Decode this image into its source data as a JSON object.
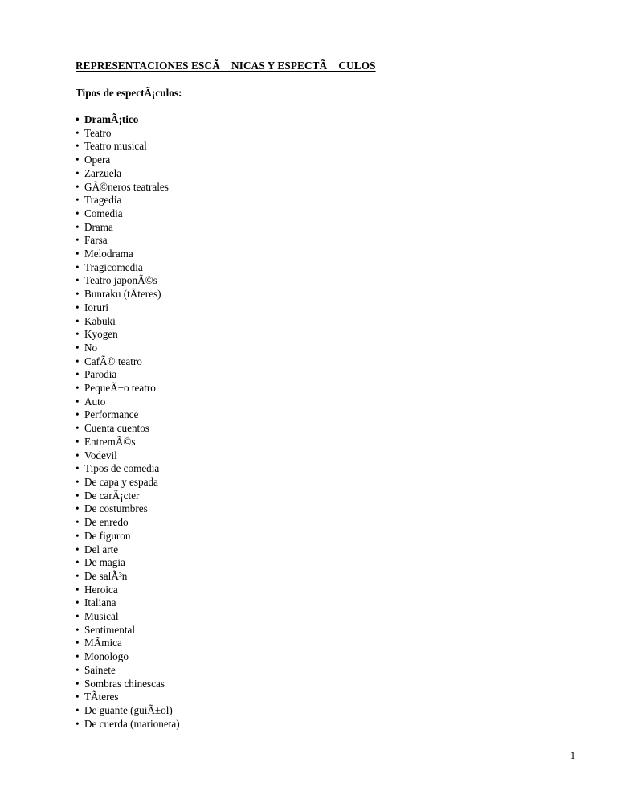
{
  "document": {
    "title": "REPRESENTACIONES ESCÃ NICAS Y ESPECTÃ CULOS",
    "subheading": "Tipos de espectÃ¡culos:",
    "page_number": "1",
    "bullet_glyph": "•",
    "text_color": "#000000",
    "background_color": "#ffffff",
    "items": [
      {
        "label": "DramÃ¡tico",
        "bold": true
      },
      {
        "label": "Teatro",
        "bold": false
      },
      {
        "label": "Teatro musical",
        "bold": false
      },
      {
        "label": "Opera",
        "bold": false
      },
      {
        "label": "Zarzuela",
        "bold": false
      },
      {
        "label": "GÃ©neros teatrales",
        "bold": false
      },
      {
        "label": "Tragedia",
        "bold": false
      },
      {
        "label": "Comedia",
        "bold": false
      },
      {
        "label": "Drama",
        "bold": false
      },
      {
        "label": "Farsa",
        "bold": false
      },
      {
        "label": "Melodrama",
        "bold": false
      },
      {
        "label": "Tragicomedia",
        "bold": false
      },
      {
        "label": "Teatro japonÃ©s",
        "bold": false
      },
      {
        "label": "Bunraku (tÃ­teres)",
        "bold": false
      },
      {
        "label": "Ioruri",
        "bold": false
      },
      {
        "label": "Kabuki",
        "bold": false
      },
      {
        "label": "Kyogen",
        "bold": false
      },
      {
        "label": "No",
        "bold": false
      },
      {
        "label": "CafÃ© teatro",
        "bold": false
      },
      {
        "label": "Parodia",
        "bold": false
      },
      {
        "label": "PequeÃ±o teatro",
        "bold": false
      },
      {
        "label": "Auto",
        "bold": false
      },
      {
        "label": "Performance",
        "bold": false
      },
      {
        "label": "Cuenta cuentos",
        "bold": false
      },
      {
        "label": "EntremÃ©s",
        "bold": false
      },
      {
        "label": "Vodevil",
        "bold": false
      },
      {
        "label": "Tipos de comedia",
        "bold": false
      },
      {
        "label": "De capa y espada",
        "bold": false
      },
      {
        "label": "De carÃ¡cter",
        "bold": false
      },
      {
        "label": "De costumbres",
        "bold": false
      },
      {
        "label": "De enredo",
        "bold": false
      },
      {
        "label": "De figuron",
        "bold": false
      },
      {
        "label": "Del arte",
        "bold": false
      },
      {
        "label": "De magia",
        "bold": false
      },
      {
        "label": "De salÃ³n",
        "bold": false
      },
      {
        "label": "Heroica",
        "bold": false
      },
      {
        "label": "Italiana",
        "bold": false
      },
      {
        "label": "Musical",
        "bold": false
      },
      {
        "label": "Sentimental",
        "bold": false
      },
      {
        "label": "MÃ­mica",
        "bold": false
      },
      {
        "label": "Monologo",
        "bold": false
      },
      {
        "label": "Sainete",
        "bold": false
      },
      {
        "label": "Sombras chinescas",
        "bold": false
      },
      {
        "label": "TÃ­teres",
        "bold": false
      },
      {
        "label": "De guante (guiÃ±ol)",
        "bold": false
      },
      {
        "label": "De cuerda (marioneta)",
        "bold": false
      }
    ]
  }
}
